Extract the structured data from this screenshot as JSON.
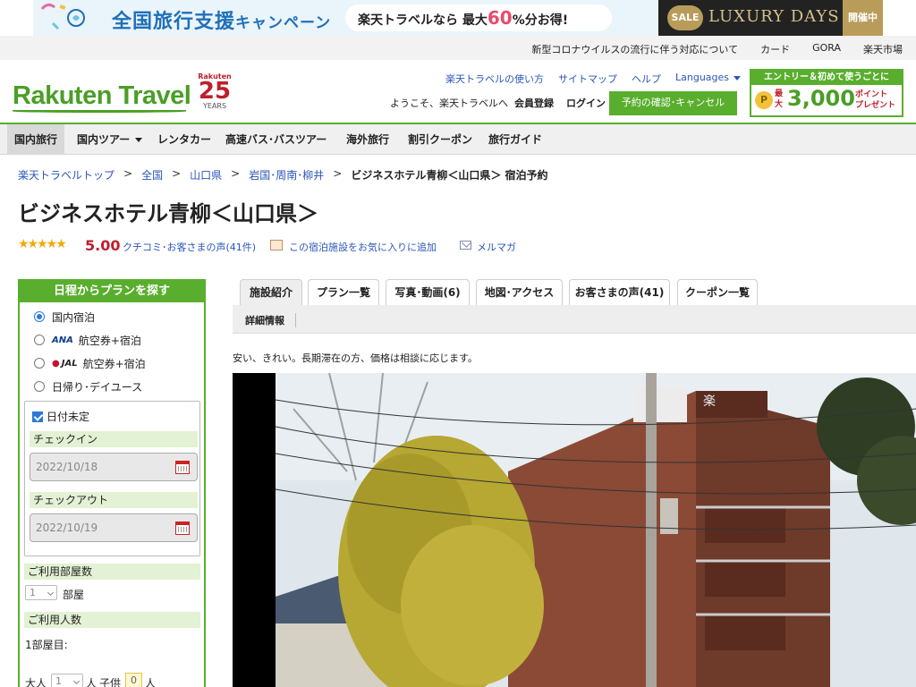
{
  "banner": {
    "title": "全国旅行支援",
    "campaign": "キャンペーン",
    "pill_prefix": "楽天トラベルなら 最大",
    "pill_percent": "60",
    "pill_suffix": "%分お得!",
    "sale": "SALE",
    "luxury": "LUXURY DAYS",
    "open": "開催中"
  },
  "util": {
    "links": [
      "新型コロナウイルスの流行に伴う対応について",
      "カード",
      "GORA",
      "楽天市場"
    ]
  },
  "header": {
    "logo": "Rakuten Travel",
    "anniv_brand": "Rakuten",
    "anniv_num": "25",
    "anniv_years": "YEARS",
    "links": [
      "楽天トラベルの使い方",
      "サイトマップ",
      "ヘルプ"
    ],
    "languages": "Languages",
    "welcome": "ようこそ、楽天トラベルへ",
    "member": "会員登録",
    "login": "ログイン",
    "reserve": "予約の確認･キャンセル",
    "promo_head": "エントリー＆初めて使うごとに",
    "promo_coin": "P",
    "promo_small": "最大",
    "promo_amount": "3,000",
    "promo_point": "ポイント\nプレゼント"
  },
  "nav": {
    "items": [
      "国内旅行",
      "国内ツアー",
      "レンタカー",
      "高速バス･バスツアー",
      "海外旅行",
      "割引クーポン",
      "旅行ガイド"
    ]
  },
  "breadcrumb": {
    "items": [
      "楽天トラベルトップ",
      "全国",
      "山口県",
      "岩国･周南･柳井"
    ],
    "current": "ビジネスホテル青柳＜山口県＞ 宿泊予約",
    "sep": ">"
  },
  "hotel": {
    "title": "ビジネスホテル青柳＜山口県＞",
    "stars": "★★★★★",
    "score": "5.00",
    "reviews": "クチコミ･お客さまの声(41件)",
    "favorite": "この宿泊施設をお気に入りに追加",
    "mailmag": "メルマガ",
    "description": "安い、きれい。長期滞在の方、価格は相談に応じます。"
  },
  "sidebar": {
    "title": "日程からプランを探す",
    "options": [
      {
        "logo": "",
        "label": "国内宿泊",
        "selected": true
      },
      {
        "logo": "ANA",
        "label": "航空券+宿泊",
        "selected": false
      },
      {
        "logo": "JAL",
        "label": "航空券+宿泊",
        "selected": false
      },
      {
        "logo": "",
        "label": "日帰り･デイユース",
        "selected": false
      }
    ],
    "date_undecided": "日付未定",
    "checkin_label": "チェックイン",
    "checkin_value": "2022/10/18",
    "checkout_label": "チェックアウト",
    "checkout_value": "2022/10/19",
    "rooms_label": "ご利用部屋数",
    "rooms_value": "1",
    "rooms_unit": "部屋",
    "people_label": "ご利用人数",
    "room1": "1部屋目:",
    "adult_label": "大人",
    "adult_value": "1",
    "adult_unit": "人",
    "child_label": "子供",
    "child_value": "0",
    "child_unit": "人"
  },
  "tabs": {
    "items": [
      "施設紹介",
      "プラン一覧",
      "写真･動画(6)",
      "地図･アクセス",
      "お客さまの声(41)",
      "クーポン一覧"
    ],
    "sub": "詳細情報"
  }
}
